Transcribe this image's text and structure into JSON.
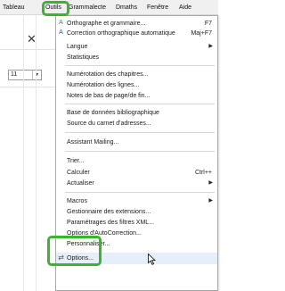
{
  "menubar": {
    "items": [
      {
        "label": "Tableau"
      },
      {
        "label": "Outils"
      },
      {
        "label": "Grammalecte"
      },
      {
        "label": "Dmaths"
      },
      {
        "label": "Fenêtre"
      },
      {
        "label": "Aide"
      }
    ]
  },
  "left": {
    "style_value": "11"
  },
  "menu": {
    "items": [
      {
        "label": "Orthographe et grammaire...",
        "shortcut": "F7",
        "icon": "spellcheck-icon"
      },
      {
        "label": "Correction orthographique automatique",
        "shortcut": "Maj+F7",
        "icon": "auto-spellcheck-icon"
      },
      {
        "label": "Langue"
      },
      {
        "label": "Statistiques"
      },
      {
        "label": "Numérotation des chapitres..."
      },
      {
        "label": "Numérotation des lignes..."
      },
      {
        "label": "Notes de bas de page/de fin..."
      },
      {
        "label": "Base de données bibliographique"
      },
      {
        "label": "Source du carnet d'adresses..."
      },
      {
        "label": "Assistant Mailing..."
      },
      {
        "label": "Trier..."
      },
      {
        "label": "Calculer",
        "shortcut": "Ctrl++"
      },
      {
        "label": "Actualiser"
      },
      {
        "label": "Macros"
      },
      {
        "label": "Gestionnaire des extensions..."
      },
      {
        "label": "Paramétrages des filtres XML..."
      },
      {
        "label": "Options d'AutoCorrection..."
      },
      {
        "label": "Personnaliser..."
      },
      {
        "label": "Options...",
        "icon": "options-icon"
      }
    ]
  },
  "colors": {
    "highlight_green": "#3cb431",
    "menu_hover": "#e5effb"
  }
}
